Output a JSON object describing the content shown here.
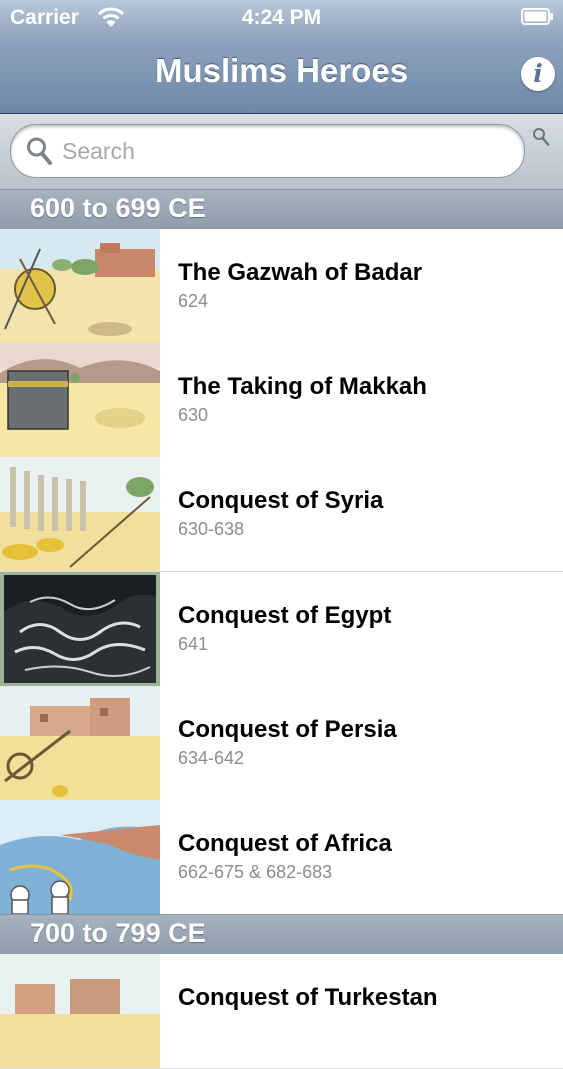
{
  "status_bar": {
    "carrier": "Carrier",
    "time": "4:24 PM"
  },
  "nav": {
    "title": "Muslims Heroes",
    "info_icon": "info-icon",
    "info_glyph": "i"
  },
  "search": {
    "placeholder": "Search",
    "icon": "search-icon"
  },
  "sections": [
    {
      "header": "600 to 699 CE",
      "items": [
        {
          "title": "The Gazwah of Badar",
          "subtitle": "624"
        },
        {
          "title": "The Taking of Makkah",
          "subtitle": "630"
        },
        {
          "title": "Conquest of Syria",
          "subtitle": "630-638"
        },
        {
          "title": "Conquest of Egypt",
          "subtitle": "641"
        },
        {
          "title": "Conquest of Persia",
          "subtitle": "634-642"
        },
        {
          "title": "Conquest of Africa",
          "subtitle": " 662-675 & 682-683"
        }
      ]
    },
    {
      "header": "700 to 799 CE",
      "items": [
        {
          "title": "Conquest of Turkestan",
          "subtitle": ""
        }
      ]
    }
  ],
  "colors": {
    "nav_bar": "#6e88a8",
    "section_header": "#98a4b2",
    "subtitle_text": "#8c8c8c"
  }
}
